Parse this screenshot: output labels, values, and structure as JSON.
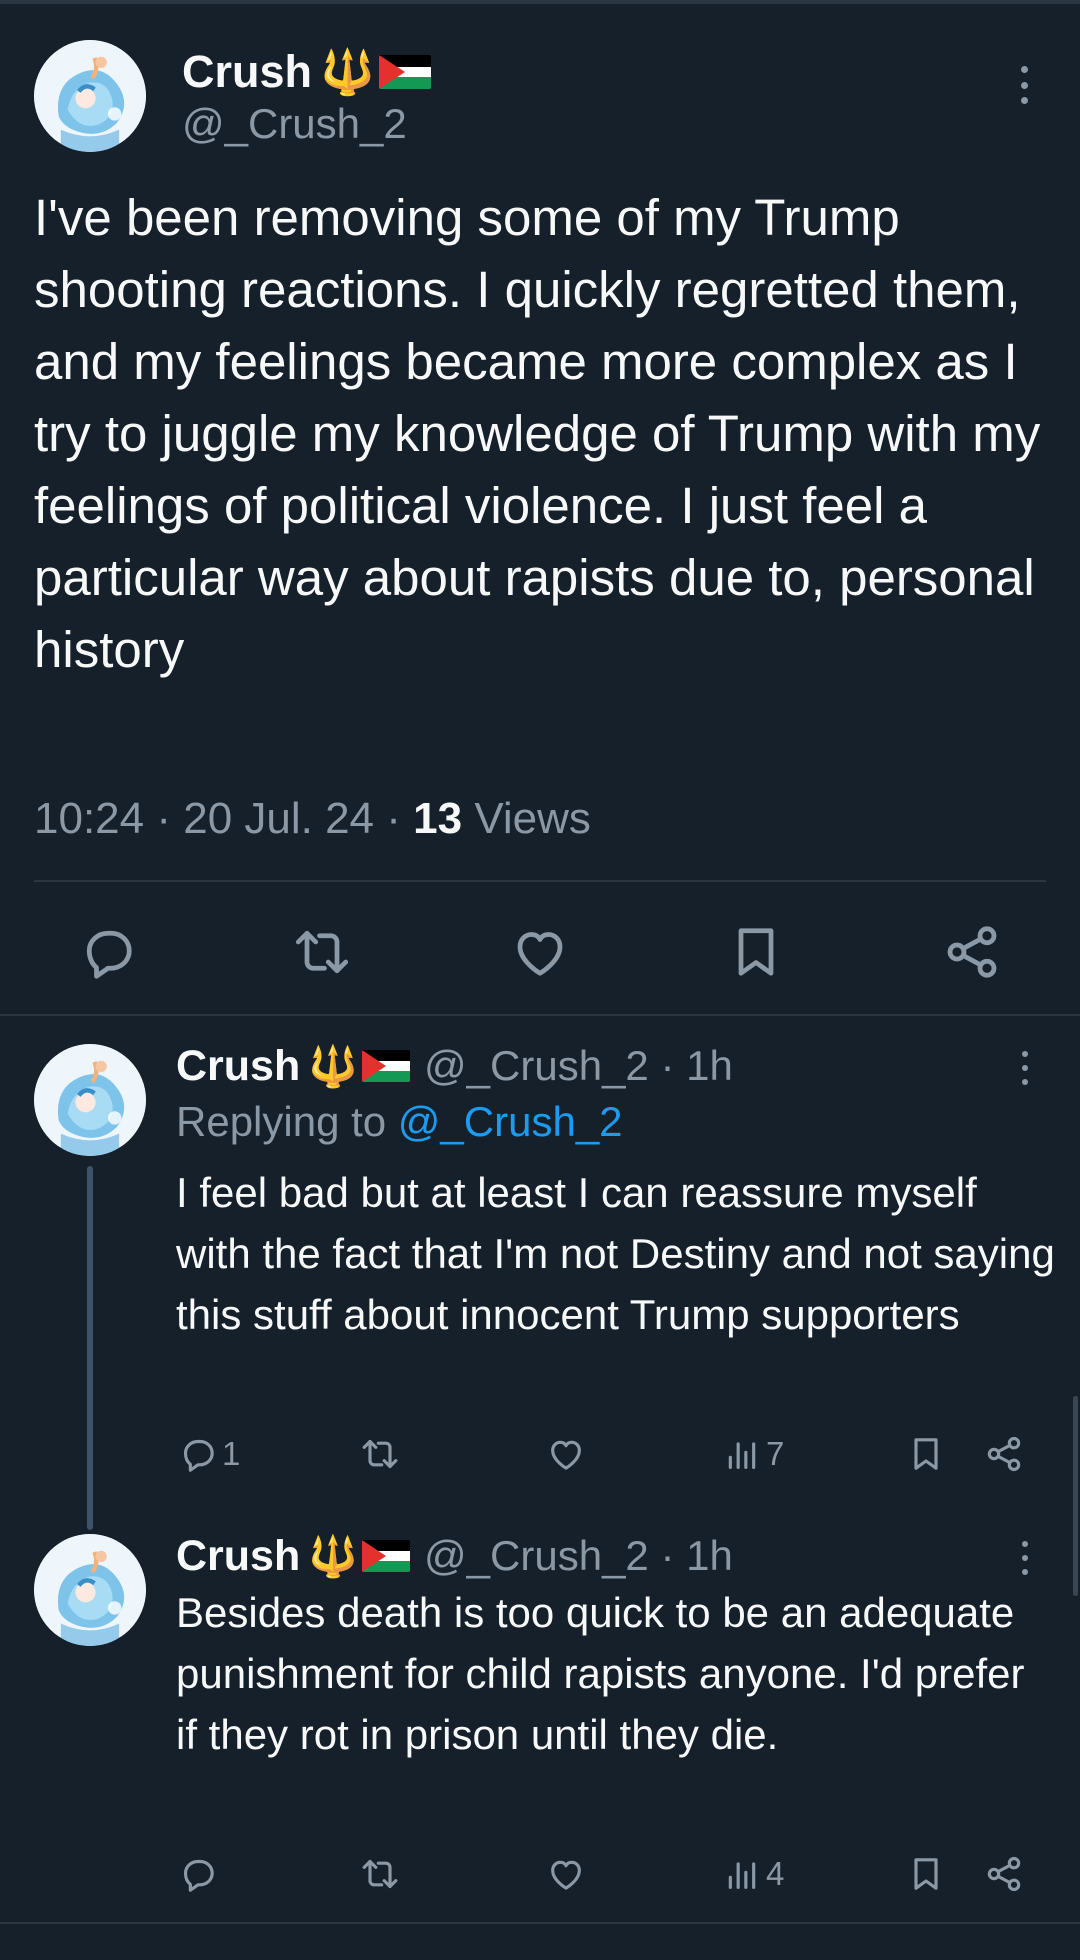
{
  "main_tweet": {
    "author_name": "Crush",
    "author_emoji_trident": "🔱",
    "author_handle": "@_Crush_2",
    "text": "I've been removing some of my Trump shooting reactions. I quickly regretted them, and my feelings became more complex as I try to juggle my knowledge of Trump with my feelings of political violence. I just feel a particular way about rapists due to, personal history",
    "time": "10:24",
    "date": "20 Jul. 24",
    "views_count": "13",
    "views_label": "Views",
    "separator": " · ",
    "actions": [
      "reply-icon",
      "retweet-icon",
      "like-icon",
      "bookmark-icon",
      "share-icon"
    ]
  },
  "replies": [
    {
      "author_name": "Crush",
      "author_emoji_trident": "🔱",
      "handle_time": "@_Crush_2 · 1h",
      "replying_label": "Replying to",
      "replying_mention": "@_Crush_2",
      "text": "I feel bad but at least I can reassure myself with the fact that I'm not Destiny and not saying this stuff about innocent Trump supporters",
      "reply_count": "1",
      "retweet_count": "",
      "like_count": "",
      "views_count": "7"
    },
    {
      "author_name": "Crush",
      "author_emoji_trident": "🔱",
      "handle_time": "@_Crush_2 · 1h",
      "text": "Besides death is too quick to be an adequate punishment for child rapists anyone. I'd prefer if they rot in prison until they die.",
      "reply_count": "",
      "retweet_count": "",
      "like_count": "",
      "views_count": "4"
    }
  ],
  "colors": {
    "background": "#15202b",
    "text_primary": "#f7f9f9",
    "text_secondary": "#8b98a5",
    "link": "#1d9bf0",
    "divider": "#2a3642",
    "thread_line": "#3d5466"
  }
}
